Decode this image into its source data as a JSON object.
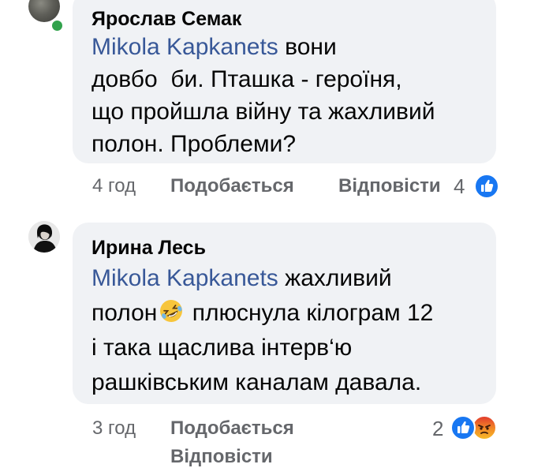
{
  "comments": [
    {
      "author": "Ярослав Семак",
      "mention": "Mikola Kapkanets",
      "text_line1_rest": " вони",
      "text_line2": "довбо ‌  би. Пташка - героїня,",
      "text_line3": "що пройшла війну та жахливий",
      "text_line4": "полон. Проблеми?",
      "time": "4 год",
      "like_label": "Подобається",
      "reply_label": "Відповісти",
      "reaction_count": "4",
      "reactions": [
        "like-icon"
      ],
      "author_online": true
    },
    {
      "author": "Ирина Лесь",
      "mention": "Mikola Kapkanets",
      "text_line1_rest": " жахливий",
      "text_line2_start": "полон",
      "text_line2_end": " плюснула кілограм 12",
      "text_line3": "і така щаслива інтерв‘ю",
      "text_line4": "рашківським каналам давала.",
      "inline_emoji": "rolling-on-floor-laughing",
      "time": "3 год",
      "like_label": "Подобається",
      "reply_label": "Відповісти",
      "reaction_count": "2",
      "reactions": [
        "like-icon",
        "angry-icon"
      ]
    }
  ],
  "colors": {
    "bubble": "#f0f2f5",
    "mention": "#385898",
    "meta": "#65676b",
    "like": "#1877f2",
    "online": "#31a24c"
  }
}
